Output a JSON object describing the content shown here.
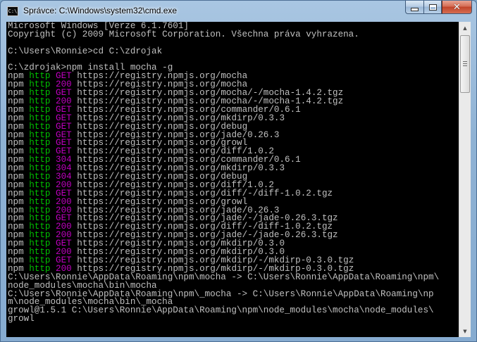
{
  "window": {
    "title": "Správce: C:\\Windows\\system32\\cmd.exe",
    "icon": "cmd-icon",
    "icon_glyph": "C:\\"
  },
  "caption_buttons": {
    "minimize": "minimize-icon",
    "maximize": "maximize-icon",
    "close": "close-icon",
    "close_glyph": "✕"
  },
  "console": {
    "background": "#000000",
    "text_color": "#c0c0c0",
    "colors": {
      "http": "#00c000",
      "method_status": "#c000c0"
    },
    "lines": [
      {
        "a": "Microsoft Windows [Verze 6.1.7601]"
      },
      {
        "a": "Copyright (c) 2009 Microsoft Corporation. Všechna práva vyhrazena."
      },
      {
        "a": ""
      },
      {
        "a": "C:\\Users\\Ronnie>cd C:\\zdrojak"
      },
      {
        "a": ""
      },
      {
        "a": "C:\\zdrojak>npm install mocha -g"
      },
      {
        "npm": "npm",
        "http": "http",
        "code": "GET",
        "url": "https://registry.npmjs.org/mocha"
      },
      {
        "npm": "npm",
        "http": "http",
        "code": "200",
        "url": "https://registry.npmjs.org/mocha"
      },
      {
        "npm": "npm",
        "http": "http",
        "code": "GET",
        "url": "https://registry.npmjs.org/mocha/-/mocha-1.4.2.tgz"
      },
      {
        "npm": "npm",
        "http": "http",
        "code": "200",
        "url": "https://registry.npmjs.org/mocha/-/mocha-1.4.2.tgz"
      },
      {
        "npm": "npm",
        "http": "http",
        "code": "GET",
        "url": "https://registry.npmjs.org/commander/0.6.1"
      },
      {
        "npm": "npm",
        "http": "http",
        "code": "GET",
        "url": "https://registry.npmjs.org/mkdirp/0.3.3"
      },
      {
        "npm": "npm",
        "http": "http",
        "code": "GET",
        "url": "https://registry.npmjs.org/debug"
      },
      {
        "npm": "npm",
        "http": "http",
        "code": "GET",
        "url": "https://registry.npmjs.org/jade/0.26.3"
      },
      {
        "npm": "npm",
        "http": "http",
        "code": "GET",
        "url": "https://registry.npmjs.org/growl"
      },
      {
        "npm": "npm",
        "http": "http",
        "code": "GET",
        "url": "https://registry.npmjs.org/diff/1.0.2"
      },
      {
        "npm": "npm",
        "http": "http",
        "code": "304",
        "url": "https://registry.npmjs.org/commander/0.6.1"
      },
      {
        "npm": "npm",
        "http": "http",
        "code": "304",
        "url": "https://registry.npmjs.org/mkdirp/0.3.3"
      },
      {
        "npm": "npm",
        "http": "http",
        "code": "304",
        "url": "https://registry.npmjs.org/debug"
      },
      {
        "npm": "npm",
        "http": "http",
        "code": "200",
        "url": "https://registry.npmjs.org/diff/1.0.2"
      },
      {
        "npm": "npm",
        "http": "http",
        "code": "GET",
        "url": "https://registry.npmjs.org/diff/-/diff-1.0.2.tgz"
      },
      {
        "npm": "npm",
        "http": "http",
        "code": "200",
        "url": "https://registry.npmjs.org/growl"
      },
      {
        "npm": "npm",
        "http": "http",
        "code": "200",
        "url": "https://registry.npmjs.org/jade/0.26.3"
      },
      {
        "npm": "npm",
        "http": "http",
        "code": "GET",
        "url": "https://registry.npmjs.org/jade/-/jade-0.26.3.tgz"
      },
      {
        "npm": "npm",
        "http": "http",
        "code": "200",
        "url": "https://registry.npmjs.org/diff/-/diff-1.0.2.tgz"
      },
      {
        "npm": "npm",
        "http": "http",
        "code": "200",
        "url": "https://registry.npmjs.org/jade/-/jade-0.26.3.tgz"
      },
      {
        "npm": "npm",
        "http": "http",
        "code": "GET",
        "url": "https://registry.npmjs.org/mkdirp/0.3.0"
      },
      {
        "npm": "npm",
        "http": "http",
        "code": "200",
        "url": "https://registry.npmjs.org/mkdirp/0.3.0"
      },
      {
        "npm": "npm",
        "http": "http",
        "code": "GET",
        "url": "https://registry.npmjs.org/mkdirp/-/mkdirp-0.3.0.tgz"
      },
      {
        "npm": "npm",
        "http": "http",
        "code": "200",
        "url": "https://registry.npmjs.org/mkdirp/-/mkdirp-0.3.0.tgz"
      },
      {
        "a": "C:\\Users\\Ronnie\\AppData\\Roaming\\npm\\mocha -> C:\\Users\\Ronnie\\AppData\\Roaming\\npm\\"
      },
      {
        "a": "node_modules\\mocha\\bin\\mocha"
      },
      {
        "a": "C:\\Users\\Ronnie\\AppData\\Roaming\\npm\\_mocha -> C:\\Users\\Ronnie\\AppData\\Roaming\\np"
      },
      {
        "a": "m\\node_modules\\mocha\\bin\\_mocha"
      },
      {
        "a": "growl@1.5.1 C:\\Users\\Ronnie\\AppData\\Roaming\\npm\\node_modules\\mocha\\node_modules\\"
      },
      {
        "a": "growl"
      }
    ]
  },
  "scrollbar": {
    "up_icon": "scroll-up-arrow-icon",
    "down_icon": "scroll-down-arrow-icon",
    "up_glyph": "▲",
    "down_glyph": "▼"
  }
}
